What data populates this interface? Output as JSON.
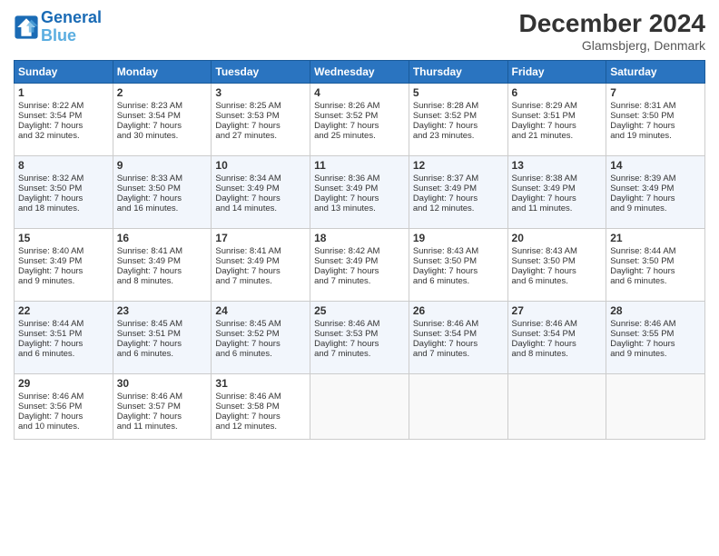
{
  "header": {
    "logo_line1": "General",
    "logo_line2": "Blue",
    "month": "December 2024",
    "location": "Glamsbjerg, Denmark"
  },
  "days_of_week": [
    "Sunday",
    "Monday",
    "Tuesday",
    "Wednesday",
    "Thursday",
    "Friday",
    "Saturday"
  ],
  "weeks": [
    [
      {
        "day": 1,
        "lines": [
          "Sunrise: 8:22 AM",
          "Sunset: 3:54 PM",
          "Daylight: 7 hours",
          "and 32 minutes."
        ]
      },
      {
        "day": 2,
        "lines": [
          "Sunrise: 8:23 AM",
          "Sunset: 3:54 PM",
          "Daylight: 7 hours",
          "and 30 minutes."
        ]
      },
      {
        "day": 3,
        "lines": [
          "Sunrise: 8:25 AM",
          "Sunset: 3:53 PM",
          "Daylight: 7 hours",
          "and 27 minutes."
        ]
      },
      {
        "day": 4,
        "lines": [
          "Sunrise: 8:26 AM",
          "Sunset: 3:52 PM",
          "Daylight: 7 hours",
          "and 25 minutes."
        ]
      },
      {
        "day": 5,
        "lines": [
          "Sunrise: 8:28 AM",
          "Sunset: 3:52 PM",
          "Daylight: 7 hours",
          "and 23 minutes."
        ]
      },
      {
        "day": 6,
        "lines": [
          "Sunrise: 8:29 AM",
          "Sunset: 3:51 PM",
          "Daylight: 7 hours",
          "and 21 minutes."
        ]
      },
      {
        "day": 7,
        "lines": [
          "Sunrise: 8:31 AM",
          "Sunset: 3:50 PM",
          "Daylight: 7 hours",
          "and 19 minutes."
        ]
      }
    ],
    [
      {
        "day": 8,
        "lines": [
          "Sunrise: 8:32 AM",
          "Sunset: 3:50 PM",
          "Daylight: 7 hours",
          "and 18 minutes."
        ]
      },
      {
        "day": 9,
        "lines": [
          "Sunrise: 8:33 AM",
          "Sunset: 3:50 PM",
          "Daylight: 7 hours",
          "and 16 minutes."
        ]
      },
      {
        "day": 10,
        "lines": [
          "Sunrise: 8:34 AM",
          "Sunset: 3:49 PM",
          "Daylight: 7 hours",
          "and 14 minutes."
        ]
      },
      {
        "day": 11,
        "lines": [
          "Sunrise: 8:36 AM",
          "Sunset: 3:49 PM",
          "Daylight: 7 hours",
          "and 13 minutes."
        ]
      },
      {
        "day": 12,
        "lines": [
          "Sunrise: 8:37 AM",
          "Sunset: 3:49 PM",
          "Daylight: 7 hours",
          "and 12 minutes."
        ]
      },
      {
        "day": 13,
        "lines": [
          "Sunrise: 8:38 AM",
          "Sunset: 3:49 PM",
          "Daylight: 7 hours",
          "and 11 minutes."
        ]
      },
      {
        "day": 14,
        "lines": [
          "Sunrise: 8:39 AM",
          "Sunset: 3:49 PM",
          "Daylight: 7 hours",
          "and 9 minutes."
        ]
      }
    ],
    [
      {
        "day": 15,
        "lines": [
          "Sunrise: 8:40 AM",
          "Sunset: 3:49 PM",
          "Daylight: 7 hours",
          "and 9 minutes."
        ]
      },
      {
        "day": 16,
        "lines": [
          "Sunrise: 8:41 AM",
          "Sunset: 3:49 PM",
          "Daylight: 7 hours",
          "and 8 minutes."
        ]
      },
      {
        "day": 17,
        "lines": [
          "Sunrise: 8:41 AM",
          "Sunset: 3:49 PM",
          "Daylight: 7 hours",
          "and 7 minutes."
        ]
      },
      {
        "day": 18,
        "lines": [
          "Sunrise: 8:42 AM",
          "Sunset: 3:49 PM",
          "Daylight: 7 hours",
          "and 7 minutes."
        ]
      },
      {
        "day": 19,
        "lines": [
          "Sunrise: 8:43 AM",
          "Sunset: 3:50 PM",
          "Daylight: 7 hours",
          "and 6 minutes."
        ]
      },
      {
        "day": 20,
        "lines": [
          "Sunrise: 8:43 AM",
          "Sunset: 3:50 PM",
          "Daylight: 7 hours",
          "and 6 minutes."
        ]
      },
      {
        "day": 21,
        "lines": [
          "Sunrise: 8:44 AM",
          "Sunset: 3:50 PM",
          "Daylight: 7 hours",
          "and 6 minutes."
        ]
      }
    ],
    [
      {
        "day": 22,
        "lines": [
          "Sunrise: 8:44 AM",
          "Sunset: 3:51 PM",
          "Daylight: 7 hours",
          "and 6 minutes."
        ]
      },
      {
        "day": 23,
        "lines": [
          "Sunrise: 8:45 AM",
          "Sunset: 3:51 PM",
          "Daylight: 7 hours",
          "and 6 minutes."
        ]
      },
      {
        "day": 24,
        "lines": [
          "Sunrise: 8:45 AM",
          "Sunset: 3:52 PM",
          "Daylight: 7 hours",
          "and 6 minutes."
        ]
      },
      {
        "day": 25,
        "lines": [
          "Sunrise: 8:46 AM",
          "Sunset: 3:53 PM",
          "Daylight: 7 hours",
          "and 7 minutes."
        ]
      },
      {
        "day": 26,
        "lines": [
          "Sunrise: 8:46 AM",
          "Sunset: 3:54 PM",
          "Daylight: 7 hours",
          "and 7 minutes."
        ]
      },
      {
        "day": 27,
        "lines": [
          "Sunrise: 8:46 AM",
          "Sunset: 3:54 PM",
          "Daylight: 7 hours",
          "and 8 minutes."
        ]
      },
      {
        "day": 28,
        "lines": [
          "Sunrise: 8:46 AM",
          "Sunset: 3:55 PM",
          "Daylight: 7 hours",
          "and 9 minutes."
        ]
      }
    ],
    [
      {
        "day": 29,
        "lines": [
          "Sunrise: 8:46 AM",
          "Sunset: 3:56 PM",
          "Daylight: 7 hours",
          "and 10 minutes."
        ]
      },
      {
        "day": 30,
        "lines": [
          "Sunrise: 8:46 AM",
          "Sunset: 3:57 PM",
          "Daylight: 7 hours",
          "and 11 minutes."
        ]
      },
      {
        "day": 31,
        "lines": [
          "Sunrise: 8:46 AM",
          "Sunset: 3:58 PM",
          "Daylight: 7 hours",
          "and 12 minutes."
        ]
      },
      null,
      null,
      null,
      null
    ]
  ]
}
